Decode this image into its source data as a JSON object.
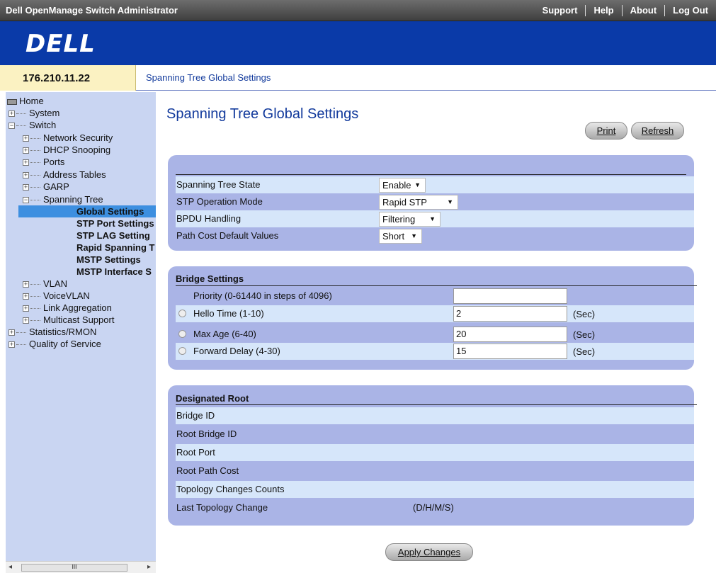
{
  "header": {
    "app_title": "Dell OpenManage Switch Administrator",
    "links": [
      "Support",
      "Help",
      "About",
      "Log Out"
    ],
    "logo": "DELL"
  },
  "address": {
    "ip": "176.210.11.22",
    "breadcrumb": "Spanning Tree Global Settings"
  },
  "sidebar": {
    "home": "Home",
    "items": [
      {
        "label": "System"
      },
      {
        "label": "Switch"
      },
      {
        "label": "Network Security"
      },
      {
        "label": "DHCP Snooping"
      },
      {
        "label": "Ports"
      },
      {
        "label": "Address Tables"
      },
      {
        "label": "GARP"
      },
      {
        "label": "Spanning Tree"
      },
      {
        "label": "Global Settings"
      },
      {
        "label": "STP Port Settings"
      },
      {
        "label": "STP LAG Setting"
      },
      {
        "label": "Rapid Spanning T"
      },
      {
        "label": "MSTP Settings"
      },
      {
        "label": "MSTP Interface S"
      },
      {
        "label": "VLAN"
      },
      {
        "label": "VoiceVLAN"
      },
      {
        "label": "Link Aggregation"
      },
      {
        "label": "Multicast Support"
      },
      {
        "label": "Statistics/RMON"
      },
      {
        "label": "Quality of Service"
      }
    ],
    "scroll_thumb": "III"
  },
  "main": {
    "title": "Spanning Tree Global Settings",
    "print_label": "Print",
    "refresh_label": "Refresh",
    "apply_label": "Apply Changes",
    "global": {
      "rows": [
        {
          "label": "Spanning Tree State",
          "value": "Enable"
        },
        {
          "label": "STP Operation Mode",
          "value": "Rapid STP"
        },
        {
          "label": "BPDU Handling",
          "value": "Filtering"
        },
        {
          "label": "Path Cost Default Values",
          "value": "Short"
        }
      ]
    },
    "bridge": {
      "heading": "Bridge Settings",
      "rows": [
        {
          "label": "Priority (0-61440 in steps of 4096)",
          "value": "",
          "unit": ""
        },
        {
          "label": "Hello Time (1-10)",
          "value": "2",
          "unit": "(Sec)"
        },
        {
          "label": "Max Age (6-40)",
          "value": "20",
          "unit": "(Sec)"
        },
        {
          "label": "Forward Delay (4-30)",
          "value": "15",
          "unit": "(Sec)"
        }
      ]
    },
    "root": {
      "heading": "Designated Root",
      "rows": [
        {
          "label": "Bridge ID",
          "value": ""
        },
        {
          "label": "Root Bridge ID",
          "value": ""
        },
        {
          "label": "Root Port",
          "value": ""
        },
        {
          "label": "Root Path Cost",
          "value": ""
        },
        {
          "label": "Topology Changes Counts",
          "value": ""
        },
        {
          "label": "Last Topology Change",
          "value": "(D/H/M/S)"
        }
      ]
    }
  }
}
